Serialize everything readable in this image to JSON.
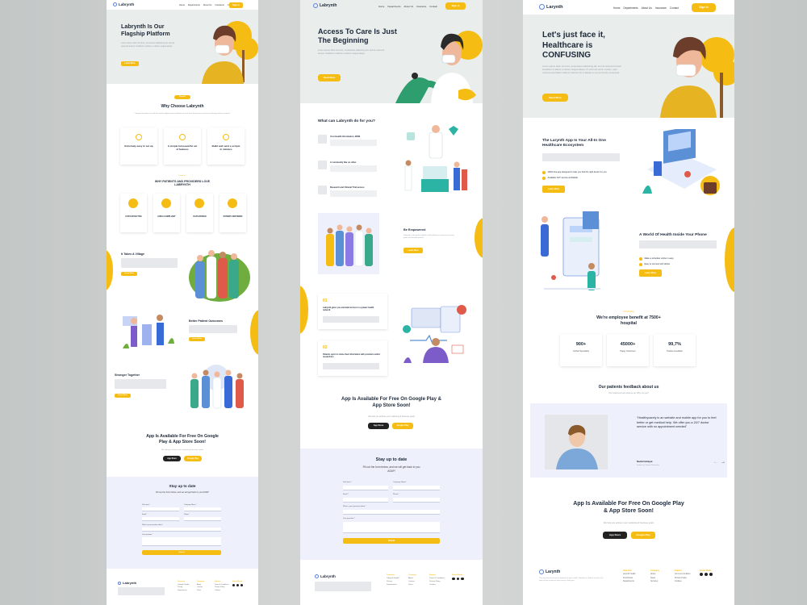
{
  "brand": "Labrynth",
  "brand_alt": "Larynth",
  "nav": [
    "Home",
    "Departments",
    "About Us",
    "Insurance",
    "Contact"
  ],
  "sign_in": "Sign in",
  "colors": {
    "accent": "#f5bd14",
    "hero_bg": "#e9eeed",
    "form_bg": "#eef0fb",
    "text": "#1d2838"
  },
  "p1": {
    "hero_title": "Labrynth Is Our Flagship Platform",
    "hero_text": "Lorem ipsum dolor sit amet, consectetur adipiscing elit, sed do eiusmod tempor incididunt ut labore et dolore magna aliqua.",
    "hero_btn": "Learn More",
    "why_tag": "Benefit",
    "why_title": "Why Choose Labrynth",
    "why_text": "Labrynth provides you with the perfect digital patient platform to meet your businesses and ever-evolving patient to market.",
    "cards": [
      "Extremely easy to set up",
      "A simple but powerful set of features",
      "Build and send e-scripts in minutes"
    ],
    "love_tag": "Features",
    "love_title": "WHY PATIENTS AND PROVIDERS LOVE LABRYNTH",
    "features": [
      "COST-EFFECTIVE",
      "HIPAA COMPLIANT",
      "DATA DRIVEN",
      "PATIENT-CENTERED"
    ],
    "village_title": "It Takes A Village",
    "outcomes_title": "Better Patient Outcomes",
    "together_title": "Stronger Together",
    "more_btn": "Learn More",
    "app_title": "App Is Available For Free On Google Play & App Store Soon!",
    "app_text": "We help you achieve your marketing & business goals",
    "app_store": "App Store",
    "google_play": "Google Play",
    "stay_title": "Stay up to date",
    "stay_text": "Fill out the form below, and we will get back to you ASAP!",
    "f_name": "Full name *",
    "f_company": "Company Name *",
    "f_email": "Email *",
    "f_phone": "Phone *",
    "f_what": "What is your question about *",
    "f_q": "Your question *",
    "submit": "Submit",
    "footer_cols": [
      {
        "h": "Overview",
        "items": [
          "Labrynth Health",
          "Pricing",
          "Departments"
        ]
      },
      {
        "h": "Company",
        "items": [
          "About",
          "Careers",
          "Press"
        ]
      },
      {
        "h": "Explore",
        "items": [
          "Terms & Conditions",
          "Privacy Policy",
          "Cookies"
        ]
      },
      {
        "h": "Social Media",
        "items": []
      }
    ]
  },
  "p2": {
    "hero_title": "Access To Care Is Just The Beginning",
    "hero_text": "Lorem ipsum dolor sit amet, consectetur adipiscing elit, sed do eiusmod tempor incididunt ut labore et dolore magna aliqua.",
    "hero_btn": "Read More",
    "what_title": "What can Labrynth do for you?",
    "what_items": [
      "Your Health Information, NOW",
      "A community like no other",
      "Research and Clinical Trial access"
    ],
    "empower_title": "Be Empowered",
    "empower_text": "Labrynth is the perfect digital health platform to meet your needs, goals and health priorities.",
    "empower_btn": "Learn More",
    "num1": "01",
    "num1_text": "Labrynth gives you unrivaled access to a greater health network",
    "num2": "02",
    "num2_text": "Patients opt-in to share their information with providers and/or researchers",
    "app_title": "App Is Available For Free On Google Play & App Store Soon!",
    "app_text": "We help you achieve your marketing & business goals",
    "app_store": "App Store",
    "google_play": "Google Play",
    "stay_title": "Stay up to date",
    "stay_text": "Fill out the form below, and we will get back to you ASAP!",
    "f_name": "Full name *",
    "f_company": "Company Name *",
    "f_email": "Email *",
    "f_phone": "Phone *",
    "f_what": "What is your question about *",
    "f_q": "Your question *",
    "submit": "Submit"
  },
  "p3": {
    "hero_title": "Let's just face it, Healthcare is CONFUSING",
    "hero_text": "Lorem ipsum dolor sit amet, consectetur adipiscing elit, sed do eiusmod tempor incididunt ut labore et dolore magna aliqua. Ut enim ad minim veniam, quis nostrud exercitation ullamco laboris nisi ut aliquip ex ea commodo consequat.",
    "hero_btn": "Read More",
    "eco_title": "The Larynth App Is Your All-In One Healthcare Ecosystem",
    "eco_checks": [
      "100% free app designed to help you find the right doctor for you",
      "Available 24/7 service worldwide"
    ],
    "eco_btn": "Learn More",
    "world_title": "A World Of Health Inside Your Phone",
    "world_checks": [
      "Make a schedule online in easy",
      "Easy to connect with doctor"
    ],
    "world_btn": "Learn More",
    "benefit_tag": "Our Pricing",
    "benefit_title": "We're employee benefit at 7500+ hospital",
    "stats": [
      {
        "value": "900+",
        "label": "Verified Specialists"
      },
      {
        "value": "45000+",
        "label": "Happy Customers"
      },
      {
        "value": "99,7%",
        "label": "Positive Feedback"
      }
    ],
    "feedback_title": "Our patients feedback about us",
    "feedback_sub": "Our customers love what we do. Why not you?",
    "quote": "\"Healthycarely is an website and mobile app for you to feel better or get medical help. We offer you a 24/7 doctor service with no appointment needed\"",
    "author": "Naufal Hidayat",
    "author_role": "Student of Trisakti University",
    "app_title": "App Is Available For Free On Google Play & App Store Soon!",
    "app_text": "We help you achieve your marketing & business goals",
    "app_store": "App Store",
    "google_play": "Google Play",
    "footer_text": "This was this has been a notebook to your health. Whether it's mild or serious, we have all the resources necessary to help you.",
    "footer_cols": [
      {
        "h": "Overview",
        "items": [
          "Larynth Health",
          "Find Doctor",
          "Departments"
        ]
      },
      {
        "h": "Company",
        "items": [
          "About",
          "News",
          "Services"
        ]
      },
      {
        "h": "Explore",
        "items": [
          "Terms & Condition",
          "Privacy Policy",
          "Cookies"
        ]
      },
      {
        "h": "Social Media",
        "items": []
      }
    ]
  }
}
